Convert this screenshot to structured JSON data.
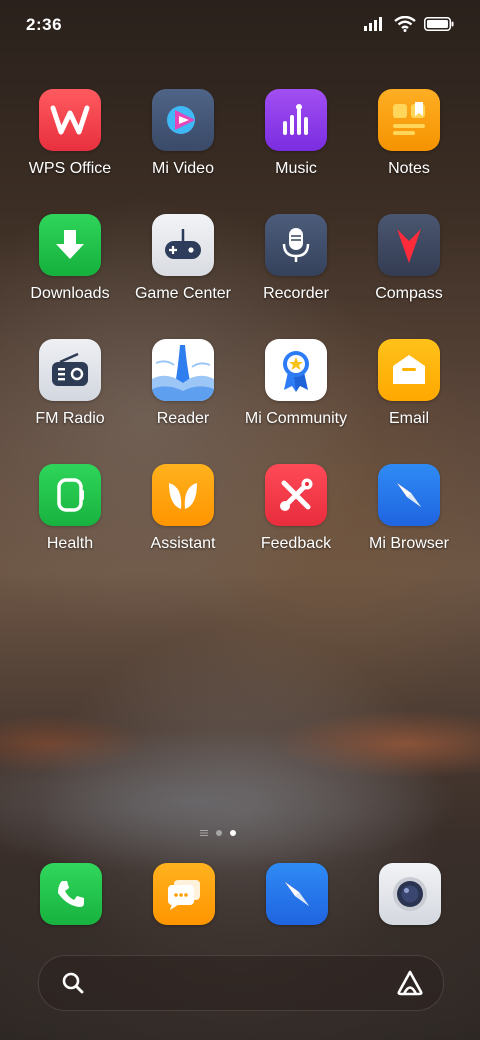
{
  "status": {
    "time": "2:36"
  },
  "apps": [
    {
      "label": "WPS Office",
      "icon": "wps-office-icon"
    },
    {
      "label": "Mi Video",
      "icon": "mi-video-icon"
    },
    {
      "label": "Music",
      "icon": "music-icon"
    },
    {
      "label": "Notes",
      "icon": "notes-icon"
    },
    {
      "label": "Downloads",
      "icon": "downloads-icon"
    },
    {
      "label": "Game Center",
      "icon": "game-center-icon"
    },
    {
      "label": "Recorder",
      "icon": "recorder-icon"
    },
    {
      "label": "Compass",
      "icon": "compass-icon"
    },
    {
      "label": "FM Radio",
      "icon": "fm-radio-icon"
    },
    {
      "label": "Reader",
      "icon": "reader-icon"
    },
    {
      "label": "Mi Community",
      "icon": "mi-community-icon"
    },
    {
      "label": "Email",
      "icon": "email-icon"
    },
    {
      "label": "Health",
      "icon": "health-icon"
    },
    {
      "label": "Assistant",
      "icon": "assistant-icon"
    },
    {
      "label": "Feedback",
      "icon": "feedback-icon"
    },
    {
      "label": "Mi Browser",
      "icon": "mi-browser-icon"
    }
  ],
  "dock": [
    "phone-icon",
    "messaging-icon",
    "browser-icon",
    "camera-icon"
  ],
  "colors": {
    "accent": "#ffffff"
  }
}
